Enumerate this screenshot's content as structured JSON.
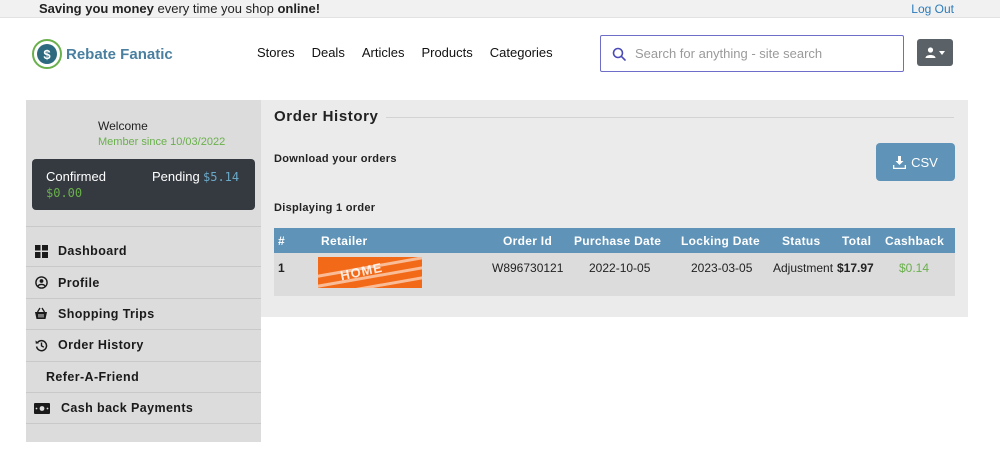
{
  "topbar": {
    "tagline_part1": "Saving you money",
    "tagline_part2": " every time you shop ",
    "tagline_part3": "online!",
    "logout_label": "Log Out"
  },
  "header": {
    "logo_text": "Rebate Fanatic",
    "logo_symbol": "$",
    "nav": [
      "Stores",
      "Deals",
      "Articles",
      "Products",
      "Categories"
    ],
    "search_placeholder": "Search for anything - site search"
  },
  "sidebar": {
    "welcome": "Welcome",
    "member_since": "Member since 10/03/2022",
    "confirmed_label": "Confirmed",
    "confirmed_value": "$0.00",
    "pending_label": "Pending",
    "pending_value": "$5.14",
    "menu": [
      {
        "label": "Dashboard",
        "icon": "dashboard-icon"
      },
      {
        "label": "Profile",
        "icon": "profile-icon"
      },
      {
        "label": "Shopping Trips",
        "icon": "basket-icon"
      },
      {
        "label": "Order History",
        "icon": "history-icon"
      },
      {
        "label": "Refer-A-Friend",
        "icon": ""
      },
      {
        "label": "Cash back Payments",
        "icon": "money-icon"
      }
    ]
  },
  "main": {
    "title": "Order History",
    "download_label": "Download your orders",
    "csv_label": "CSV",
    "displaying": "Displaying 1 order",
    "columns": [
      "#",
      "Retailer",
      "Order Id",
      "Purchase Date",
      "Locking Date",
      "Status",
      "Total",
      "Cashback"
    ],
    "rows": [
      {
        "num": "1",
        "retailer": "The Home Depot",
        "order_id": "W896730121",
        "purchase_date": "2022-10-05",
        "locking_date": "2023-03-05",
        "status": "Adjustment",
        "total": "$17.97",
        "cashback": "$0.14"
      }
    ]
  },
  "colors": {
    "accent_blue": "#5f93b8",
    "green": "#6ab04c",
    "dark_panel": "#343a40"
  }
}
